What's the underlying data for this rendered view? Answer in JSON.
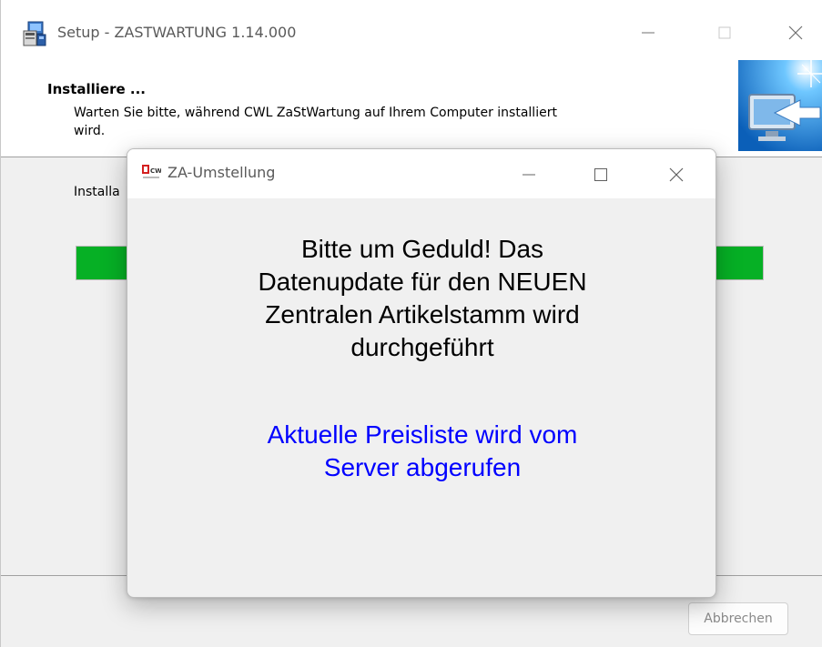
{
  "setup_window": {
    "title": "Setup - ZASTWARTUNG 1.14.000",
    "icon": "setup-installer-icon",
    "header": {
      "title": "Installiere ...",
      "description_lines": [
        "Warten Sie bitte, während CWL ZaStWartung auf Ihrem Computer installiert",
        "wird."
      ],
      "image": "monitor-install-icon"
    },
    "status_label": "Installa",
    "progress_fraction": 1.0,
    "cancel_label": "Abbrechen",
    "colors": {
      "progress": "#06b025",
      "panel": "#f0f0f0"
    }
  },
  "dialog": {
    "title": "ZA-Umstellung",
    "icon_text": "CWL",
    "message_lines": [
      "Bitte um Geduld! Das",
      "Datenupdate für den NEUEN",
      "Zentralen Artikelstamm wird",
      "durchgeführt"
    ],
    "status_lines": [
      "Aktuelle Preisliste wird vom",
      "Server abgerufen"
    ],
    "colors": {
      "status_text": "#0000ff",
      "icon_brand": "#d42020"
    }
  }
}
